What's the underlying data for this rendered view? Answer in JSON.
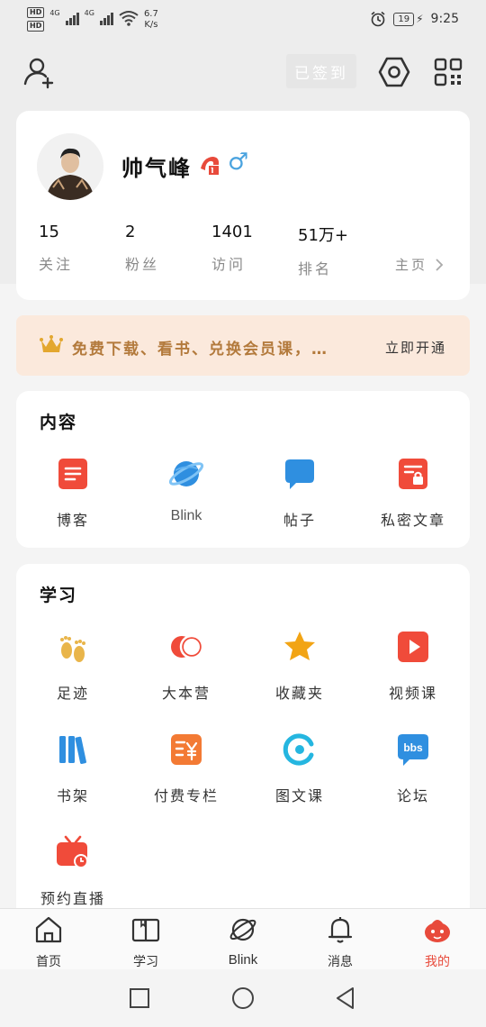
{
  "status_bar": {
    "hd1": "HD",
    "hd2": "HD",
    "net1": "4G",
    "net2": "4G",
    "speed_value": "6.7",
    "speed_unit": "K/s",
    "battery": "19",
    "time": "9:25"
  },
  "toolbar": {
    "checkin_label": "已签到"
  },
  "profile": {
    "username": "帅气峰",
    "gender_symbol": "♂",
    "stats": [
      {
        "value": "15",
        "label": "关注"
      },
      {
        "value": "2",
        "label": "粉丝"
      },
      {
        "value": "1401",
        "label": "访问"
      },
      {
        "value": "51万+",
        "label": "排名"
      }
    ],
    "homepage_label": "主页"
  },
  "vip": {
    "text": "免费下载、看书、兑换会员课，…",
    "action": "立即开通"
  },
  "content_section": {
    "title": "内容",
    "items": [
      {
        "label": "博客",
        "icon": "blog-doc-icon"
      },
      {
        "label": "Blink",
        "icon": "planet-icon"
      },
      {
        "label": "帖子",
        "icon": "chat-bubble-icon"
      },
      {
        "label": "私密文章",
        "icon": "lock-doc-icon"
      }
    ]
  },
  "learn_section": {
    "title": "学习",
    "items": [
      {
        "label": "足迹",
        "icon": "footprints-icon"
      },
      {
        "label": "大本营",
        "icon": "circles-icon"
      },
      {
        "label": "收藏夹",
        "icon": "star-icon"
      },
      {
        "label": "视频课",
        "icon": "play-icon"
      },
      {
        "label": "书架",
        "icon": "books-icon"
      },
      {
        "label": "付费专栏",
        "icon": "yuan-doc-icon"
      },
      {
        "label": "图文课",
        "icon": "ring-icon"
      },
      {
        "label": "论坛",
        "icon": "bbs-icon"
      },
      {
        "label": "预约直播",
        "icon": "tv-clock-icon"
      }
    ]
  },
  "bottom_nav": [
    {
      "label": "首页",
      "icon": "home-icon"
    },
    {
      "label": "学习",
      "icon": "book-icon"
    },
    {
      "label": "Blink",
      "icon": "planet-outline-icon"
    },
    {
      "label": "消息",
      "icon": "bell-icon"
    },
    {
      "label": "我的",
      "icon": "mine-mascot-icon",
      "active": true
    }
  ],
  "colors": {
    "accent_red": "#e84a3b",
    "blue": "#2f8fe0",
    "gold": "#b37a3c"
  }
}
